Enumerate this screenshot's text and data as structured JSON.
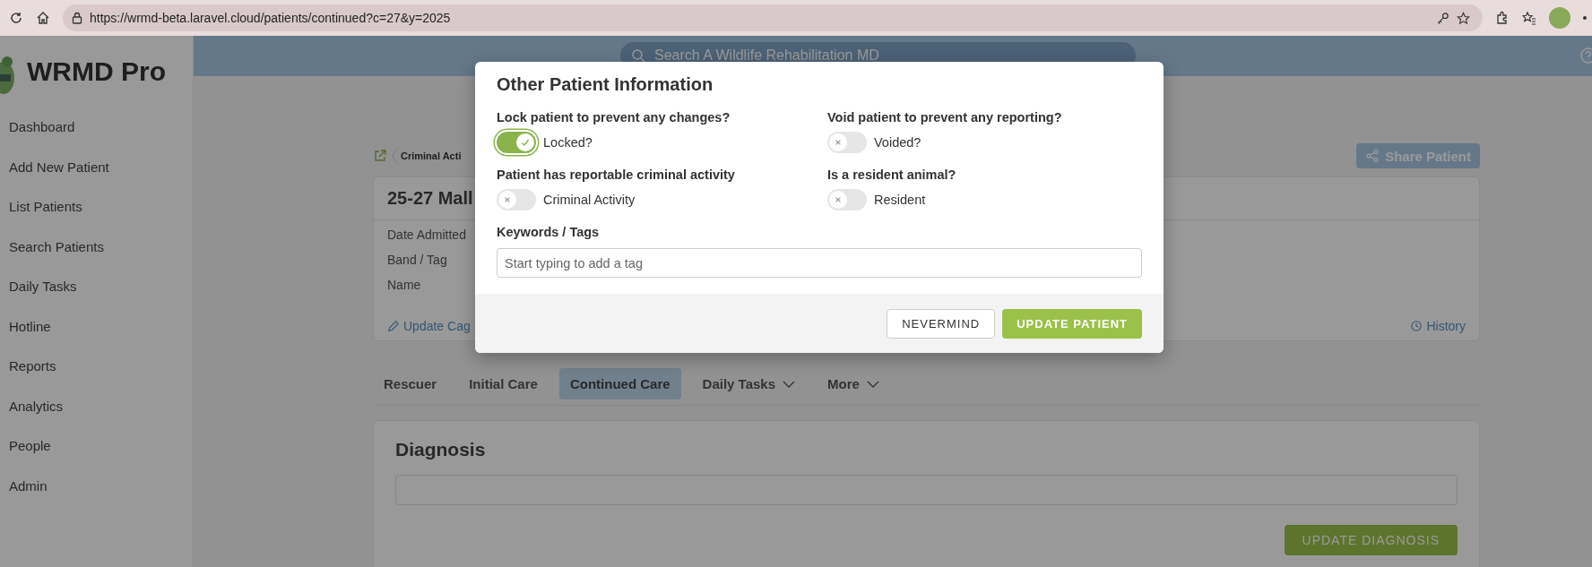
{
  "browser": {
    "url": "https://wrmd-beta.laravel.cloud/patients/continued?c=27&y=2025"
  },
  "header": {
    "search_placeholder": "Search A Wildlife Rehabilitation MD"
  },
  "sidebar": {
    "brand": "WRMD Pro",
    "items": [
      {
        "label": "Dashboard"
      },
      {
        "label": "Add New Patient"
      },
      {
        "label": "List Patients"
      },
      {
        "label": "Search Patients"
      },
      {
        "label": "Daily Tasks"
      },
      {
        "label": "Hotline"
      },
      {
        "label": "Reports"
      },
      {
        "label": "Analytics"
      },
      {
        "label": "People"
      },
      {
        "label": "Admin"
      }
    ]
  },
  "patient": {
    "breadcrumb": "Criminal Acti",
    "share": "Share Patient",
    "title": "25-27 Mall",
    "fields": [
      "Date Admitted",
      "Band / Tag",
      "Name"
    ],
    "update_link": "Update Cag",
    "history": "History"
  },
  "tabs": [
    {
      "label": "Rescuer",
      "selected": false,
      "dropdown": false
    },
    {
      "label": "Initial Care",
      "selected": false,
      "dropdown": false
    },
    {
      "label": "Continued Care",
      "selected": true,
      "dropdown": false
    },
    {
      "label": "Daily Tasks",
      "selected": false,
      "dropdown": true
    },
    {
      "label": "More",
      "selected": false,
      "dropdown": true
    }
  ],
  "diagnosis": {
    "title": "Diagnosis",
    "button": "UPDATE DIAGNOSIS"
  },
  "modal": {
    "title": "Other Patient Information",
    "toggles": [
      {
        "question": "Lock patient to prevent any changes?",
        "label": "Locked?",
        "on": true
      },
      {
        "question": "Void patient to prevent any reporting?",
        "label": "Voided?",
        "on": false
      },
      {
        "question": "Patient has reportable criminal activity",
        "label": "Criminal Activity",
        "on": false
      },
      {
        "question": "Is a resident animal?",
        "label": "Resident",
        "on": false
      }
    ],
    "tags_label": "Keywords / Tags",
    "tags_placeholder": "Start typing to add a tag",
    "cancel": "NEVERMIND",
    "submit": "UPDATE PATIENT"
  }
}
